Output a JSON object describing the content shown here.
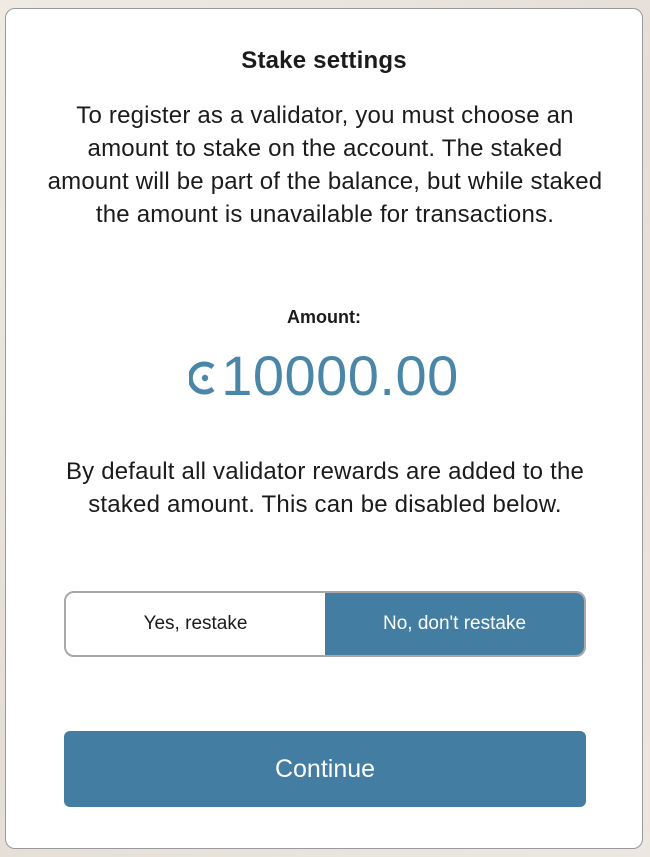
{
  "dialog": {
    "title": "Stake settings",
    "description": "To register as a validator, you must choose an amount to stake on the account. The staked amount will be part of the balance, but while staked the amount is unavailable for transactions.",
    "amount_label": "Amount:",
    "amount_value": "10000.00",
    "currency_icon": "ccd-icon",
    "rewards_text": "By default all validator rewards are added to the staked amount. This can be disabled below.",
    "restake_options": [
      {
        "label": "Yes, restake",
        "selected": false
      },
      {
        "label": "No, don't restake",
        "selected": true
      }
    ],
    "continue_label": "Continue"
  },
  "colors": {
    "accent": "#437ea2",
    "amount": "#4a86a8",
    "background": "#e7e2dc"
  }
}
